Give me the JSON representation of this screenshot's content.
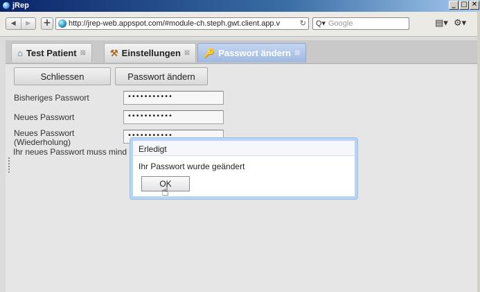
{
  "window": {
    "title": "jRep",
    "controls": [
      "_",
      "□",
      "✕"
    ]
  },
  "browser": {
    "url": "http://jrep-web.appspot.com/#module-ch.steph.gwt.client.app.v",
    "search_placeholder": "Google"
  },
  "tabs": [
    {
      "label": "Test Patient",
      "active": false
    },
    {
      "label": "Einstellungen",
      "active": false
    },
    {
      "label": "Passwort ändern",
      "active": true
    }
  ],
  "toolbar": {
    "close_label": "Schliessen",
    "change_label": "Passwort ändern"
  },
  "form": {
    "old_password_label": "Bisheriges Passwort",
    "new_password_label": "Neues Passwort",
    "repeat_label_line1": "Neues Passwort",
    "repeat_label_line2": "(Wiederholung)",
    "hint": "Ihr neues Passwort muss mind",
    "old_password_value": "•••••••••••",
    "new_password_value": "•••••••••••",
    "repeat_password_value": "•••••••••••"
  },
  "dialog": {
    "title": "Erledigt",
    "message": "Ihr Passwort wurde geändert",
    "ok_label": "OK"
  }
}
